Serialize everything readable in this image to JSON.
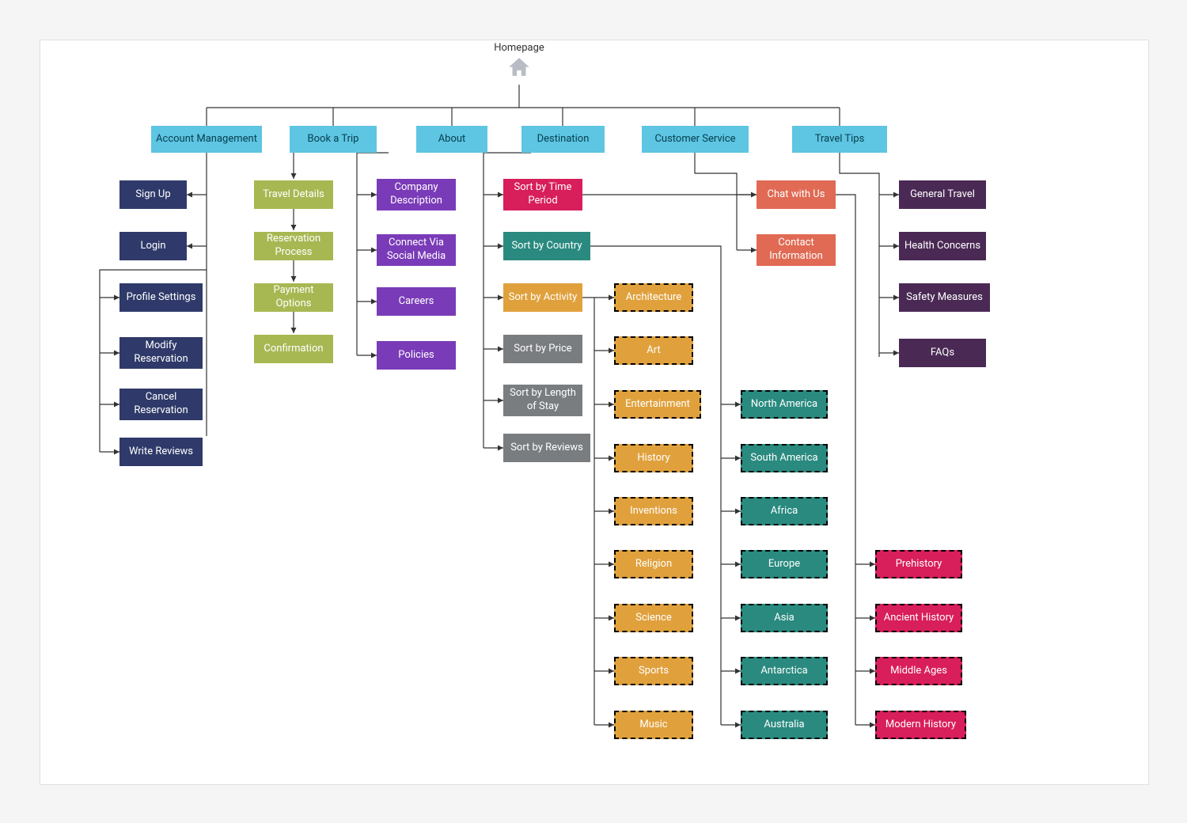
{
  "root": {
    "label": "Homepage"
  },
  "topNav": [
    "Account Management",
    "Book a Trip",
    "About",
    "Destination",
    "Customer Service",
    "Travel Tips"
  ],
  "account": [
    "Sign Up",
    "Login",
    "Profile Settings",
    "Modify Reservation",
    "Cancel Reservation",
    "Write Reviews"
  ],
  "book": [
    "Travel Details",
    "Reservation Process",
    "Payment Options",
    "Confirmation"
  ],
  "about": [
    "Company Description",
    "Connect Via Social Media",
    "Careers",
    "Policies"
  ],
  "destSort": [
    "Sort by Time Period",
    "Sort by Country",
    "Sort by Activity",
    "Sort by Price",
    "Sort by Length of Stay",
    "Sort by Reviews"
  ],
  "service": [
    "Chat with Us",
    "Contact Information"
  ],
  "tips": [
    "General Travel",
    "Health Concerns",
    "Safety Measures",
    "FAQs"
  ],
  "activities": [
    "Architecture",
    "Art",
    "Entertainment",
    "History",
    "Inventions",
    "Religion",
    "Science",
    "Sports",
    "Music"
  ],
  "countries": [
    "North America",
    "South America",
    "Africa",
    "Europe",
    "Asia",
    "Antarctica",
    "Australia"
  ],
  "periods": [
    "Prehistory",
    "Ancient History",
    "Middle Ages",
    "Modern History"
  ],
  "colors": {
    "cyan": "#5ec5e2",
    "navy": "#2f3a6a",
    "olive": "#a7b852",
    "purple": "#7a3bb8",
    "magenta": "#d81e5b",
    "teal": "#2a8a7f",
    "orange": "#e0a13d",
    "gray": "#7a7d80",
    "coral": "#e06a54",
    "plum": "#4a2a54"
  }
}
